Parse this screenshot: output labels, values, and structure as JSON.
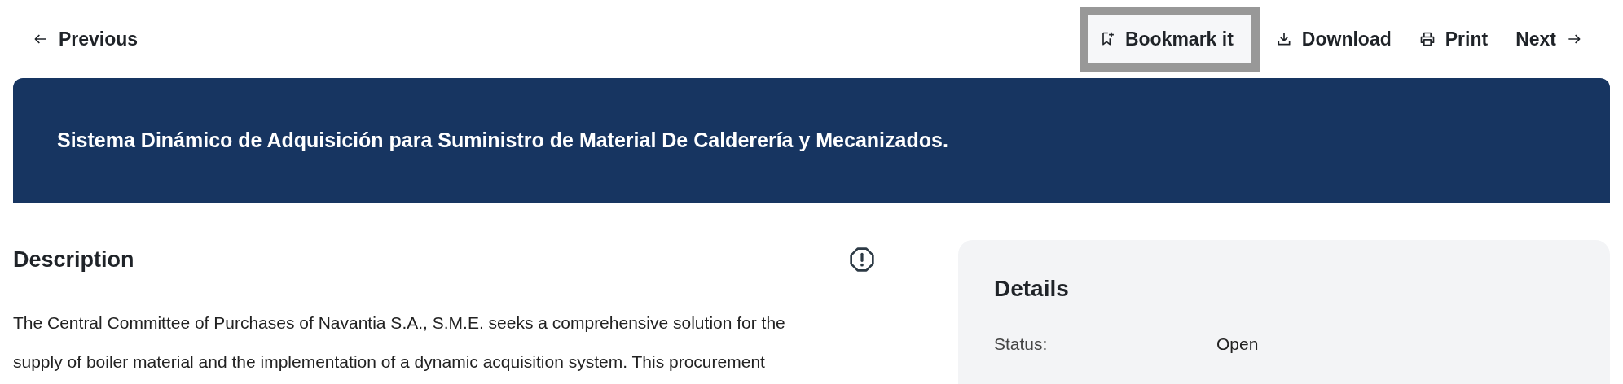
{
  "nav": {
    "previous": "Previous",
    "actions": [
      {
        "kind": "bookmark",
        "label": "Bookmark it",
        "focused": true
      },
      {
        "kind": "download",
        "label": "Download",
        "focused": false
      },
      {
        "kind": "print",
        "label": "Print",
        "focused": false
      }
    ],
    "next": "Next"
  },
  "banner": {
    "title": "Sistema Dinámico de Adquisición para Suministro de Material De Calderería y Mecanizados."
  },
  "description": {
    "heading": "Description",
    "lines": [
      "The Central Committee of Purchases of Navantia S.A., S.M.E. seeks a comprehensive solution for the",
      "supply of boiler material and the implementation of a dynamic acquisition system. This procurement"
    ]
  },
  "details": {
    "heading": "Details",
    "rows": [
      {
        "label": "Status:",
        "value": "Open"
      }
    ]
  }
}
